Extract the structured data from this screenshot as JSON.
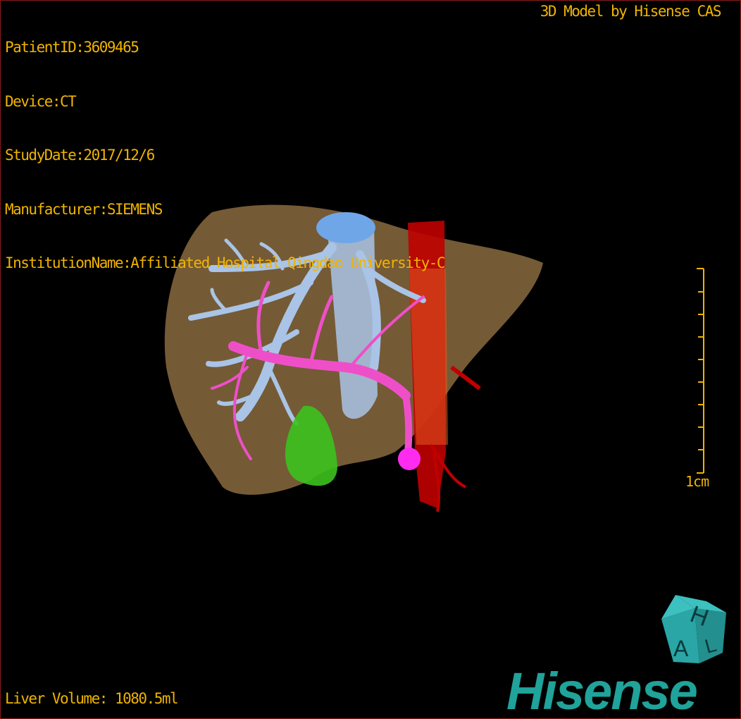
{
  "patient_info": {
    "patient_id": "PatientID:3609465",
    "device": "Device:CT",
    "study_date": "StudyDate:2017/12/6",
    "manufacturer": "Manufacturer:SIEMENS",
    "institution": "InstitutionName:Affiliated Hospital Qingdao University-C"
  },
  "brand_title": "3D Model by Hisense CAS",
  "scale_bar": {
    "label": "1cm"
  },
  "liver_volume": "Liver Volume: 1080.5ml",
  "orientation_cube": {
    "faces": [
      "H",
      "A",
      "L"
    ],
    "color": "#2aa6a6"
  },
  "logo": {
    "text": "Hisense",
    "color": "#1fa39a"
  },
  "colors": {
    "text": "#f0b400",
    "border": "#8b1a1a",
    "liver": "#8a6a3f",
    "hepatic_vein": "#a9c4e6",
    "portal_vein": "#ee4fc8",
    "artery": "#c00000",
    "gallbladder": "#3cc21e",
    "tumor": "#ff2cf0"
  }
}
